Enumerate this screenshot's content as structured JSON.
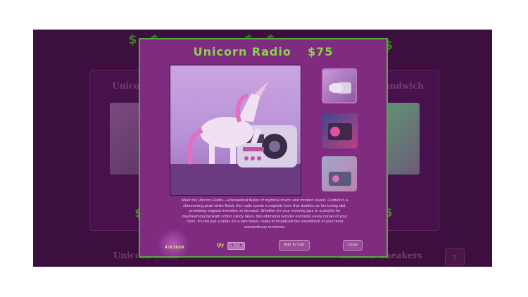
{
  "modal": {
    "title": "Unicorn Radio",
    "price": "$75",
    "description": "Meet the Unicorn Radio—a fantastical fusion of mythical charm and modern sound. Crafted in a shimmering pearl-white finish, this radio sports a majestic horn that doubles as the tuning dial, promising magical melodies on demand. Whether it's your morning jazz or a playlist for daydreaming beneath cotton candy skies, this whimsical wonder enchants every corner of your room. It's not just a radio; it's a rare beast, ready to broadcast the soundtrack of your most extraordinary moments.",
    "stock": "4 in stock",
    "qty_label": "Qty",
    "qty_value": "1",
    "add_to_cart": "Add To Cart",
    "close": "Close"
  },
  "background": {
    "cards": [
      {
        "title": "Unicorn Radio",
        "price": "$75"
      },
      {
        "title": "Unicorn Sandwich",
        "price": "$75"
      },
      {
        "title": "Unicorn Shirt"
      },
      {
        "title": "Unicorn Sneakers"
      }
    ],
    "top_prices": [
      "$ $",
      "$ $",
      "$ $"
    ],
    "scroll_top_icon": "arrow-up-icon"
  },
  "colors": {
    "overlay": "#3d0f3f",
    "modal_bg": "#7e2b80",
    "accent_green": "#8ed053",
    "border_green": "#58a640"
  }
}
